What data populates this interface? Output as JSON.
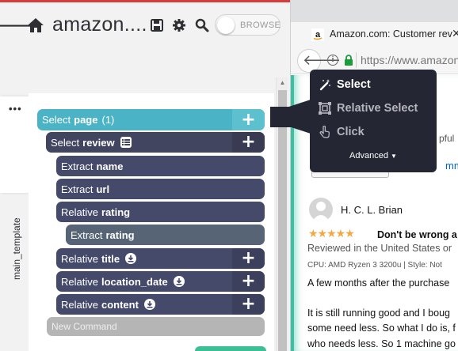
{
  "extension": {
    "app_title": "amazon....",
    "browse_toggle_label": "BROWSE",
    "template_tab_label": "main_template",
    "colors": {
      "accent_red": "#d93a3a",
      "select_page": "#4ab3c5",
      "node_dark": "#454a6b",
      "node_muted": "#566476",
      "new_command": "#b5b5b5"
    },
    "tree": {
      "select_page": {
        "verb": "Select",
        "target": "page",
        "count": "(1)"
      },
      "select_review": {
        "verb": "Select",
        "target": "review"
      },
      "extract_name": {
        "verb": "Extract",
        "target": "name"
      },
      "extract_url": {
        "verb": "Extract",
        "target": "url"
      },
      "relative_rating": {
        "verb": "Relative",
        "target": "rating"
      },
      "extract_rating": {
        "verb": "Extract",
        "target": "rating"
      },
      "relative_title": {
        "verb": "Relative",
        "target": "title"
      },
      "relative_location_date": {
        "verb": "Relative",
        "target": "location_date"
      },
      "relative_content": {
        "verb": "Relative",
        "target": "content"
      },
      "new_command": "New Command"
    }
  },
  "popover": {
    "select": "Select",
    "relative_select": "Relative Select",
    "click": "Click",
    "advanced": "Advanced"
  },
  "browser": {
    "tab_title": "Amazon.com: Customer rev",
    "url": "https://www.amazon",
    "helpful_fragment": "pful",
    "comment_fragment": "mme",
    "review": {
      "reviewer": "H. C. L. Brian",
      "stars": "★★★★★",
      "title": "Don't be wrong a",
      "place": "Reviewed in the United States or",
      "meta": "CPU: AMD Ryzen 3 3200u  |  Style: Not",
      "p1": "A few months after the purchase",
      "p2": "It is still running good and I boug",
      "p3": "some need less. So what I do is, f",
      "p4": "who needs less. So 1 machine go"
    }
  }
}
